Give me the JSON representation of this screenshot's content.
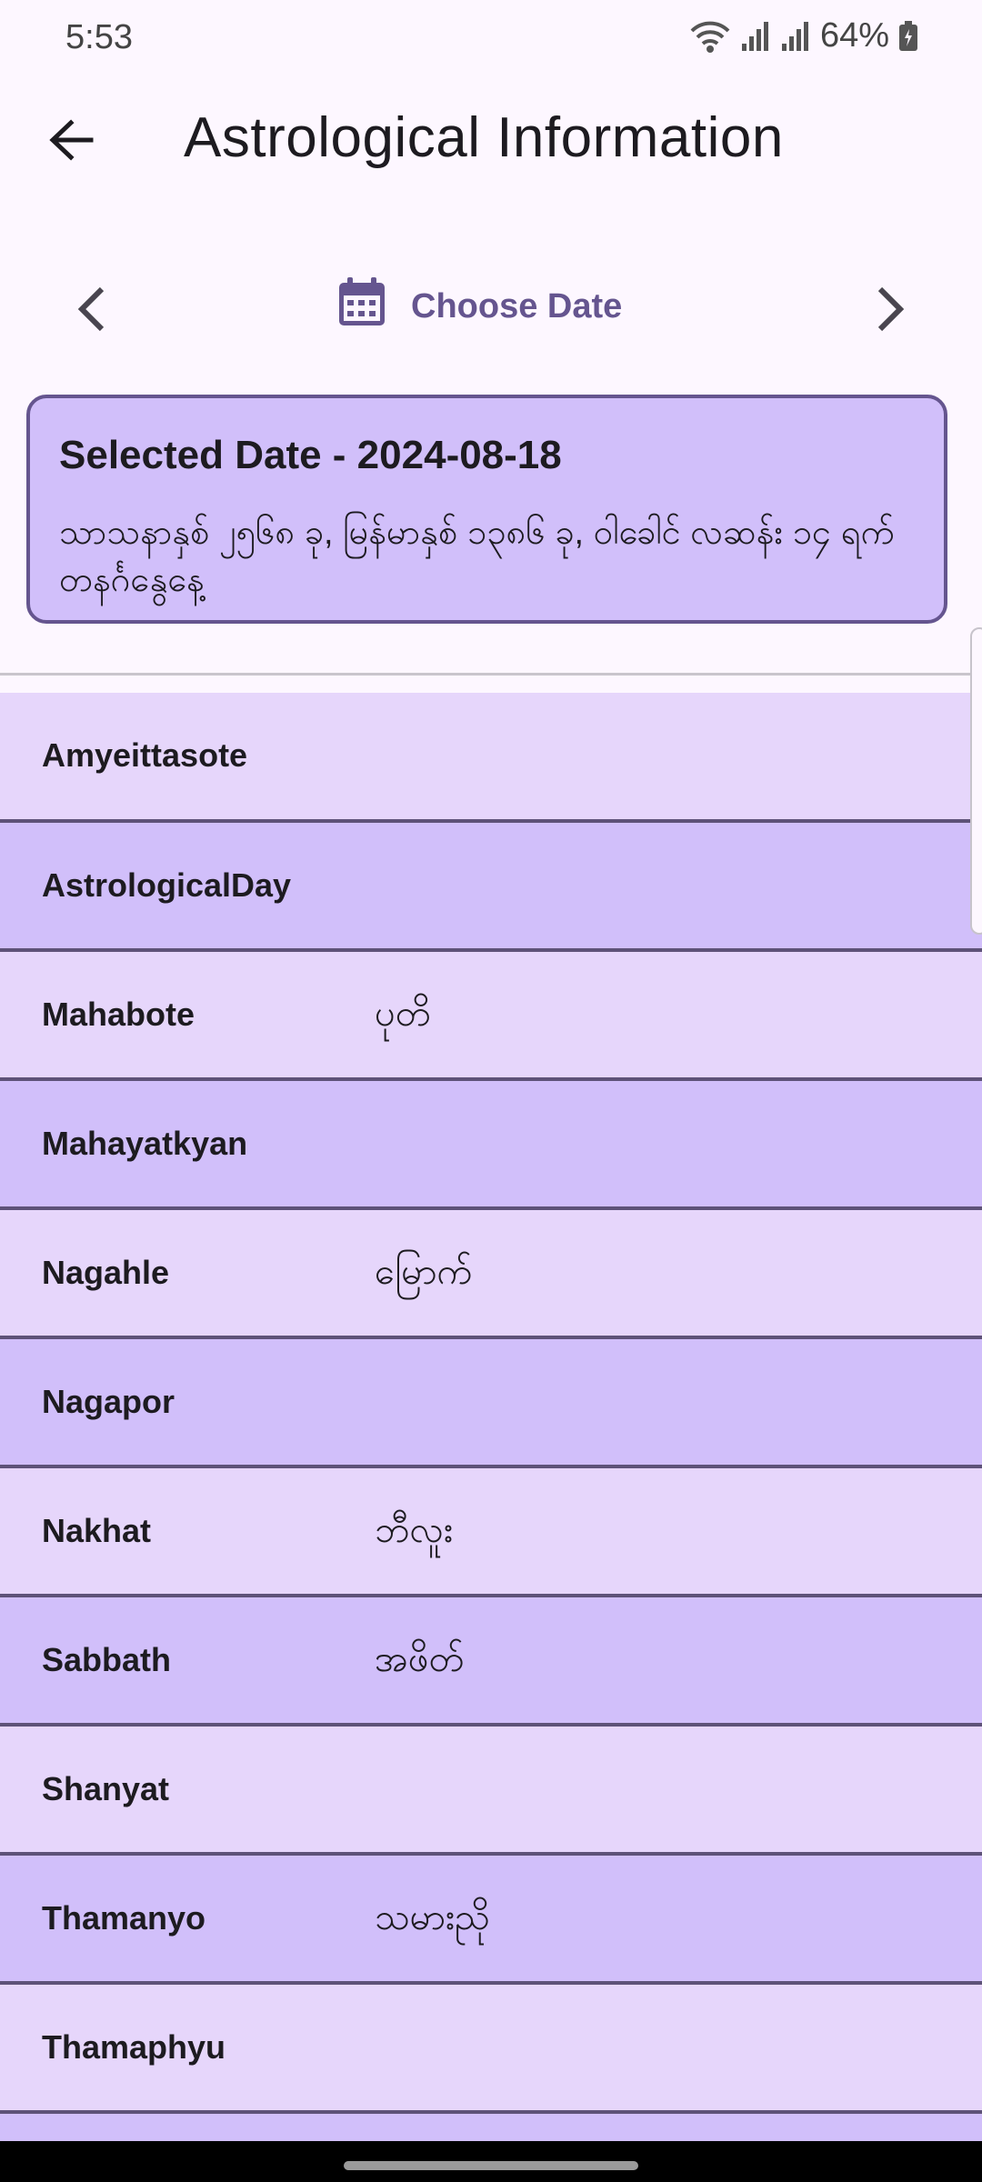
{
  "status_bar": {
    "time": "5:53",
    "battery": "64%"
  },
  "app_bar": {
    "title": "Astrological Information"
  },
  "date_nav": {
    "choose_label": "Choose Date"
  },
  "selected": {
    "title": "Selected Date - 2024-08-18",
    "description": "သာသနာနှစ် ၂၅၆၈ ခု, မြန်မာနှစ် ၁၃၈၆ ခု, ဝါခေါင် လဆန်း ၁၄ ရက် တနင်္ဂနွေနေ့"
  },
  "rows": [
    {
      "label": "Amyeittasote",
      "value": ""
    },
    {
      "label": "AstrologicalDay",
      "value": ""
    },
    {
      "label": "Mahabote",
      "value": "ပုတိ"
    },
    {
      "label": "Mahayatkyan",
      "value": ""
    },
    {
      "label": "Nagahle",
      "value": "မြောက်"
    },
    {
      "label": "Nagapor",
      "value": ""
    },
    {
      "label": "Nakhat",
      "value": "ဘီလူး"
    },
    {
      "label": "Sabbath",
      "value": "အဖိတ်"
    },
    {
      "label": "Shanyat",
      "value": ""
    },
    {
      "label": "Thamanyo",
      "value": "သမားညို"
    },
    {
      "label": "Thamaphyu",
      "value": ""
    }
  ],
  "colors": {
    "accent": "#65558f",
    "card_bg": "#d1bffa",
    "row_light": "#e6d6fb",
    "row_dark": "#d1bffa",
    "background": "#fdf7ff"
  }
}
